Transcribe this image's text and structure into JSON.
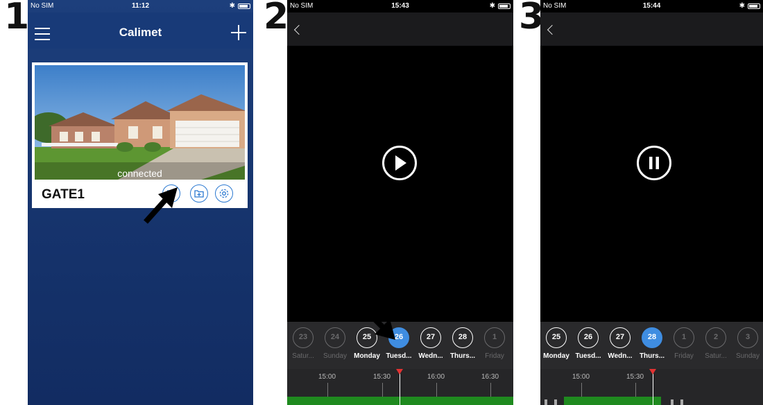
{
  "steps": [
    "1",
    "2",
    "3"
  ],
  "phone1": {
    "status": {
      "carrier": "No SIM",
      "time": "11:12"
    },
    "title": "Calimet",
    "card": {
      "status": "connected",
      "name": "GATE1"
    },
    "icons": [
      "menu-icon",
      "add-icon",
      "playback-list-icon",
      "add-folder-icon",
      "gear-icon"
    ]
  },
  "phone2": {
    "status": {
      "carrier": "No SIM",
      "time": "15:43"
    },
    "control": "play-icon",
    "days": [
      {
        "num": "23",
        "label": "Satur...",
        "state": "dim"
      },
      {
        "num": "24",
        "label": "Sunday",
        "state": "dim"
      },
      {
        "num": "25",
        "label": "Monday",
        "state": "active"
      },
      {
        "num": "26",
        "label": "Tuesd...",
        "state": "selected"
      },
      {
        "num": "27",
        "label": "Wedn...",
        "state": "active"
      },
      {
        "num": "28",
        "label": "Thurs...",
        "state": "active"
      },
      {
        "num": "1",
        "label": "Friday",
        "state": "dim"
      }
    ],
    "timeline": [
      "15:00",
      "15:30",
      "16:00",
      "16:30"
    ]
  },
  "phone3": {
    "status": {
      "carrier": "No SIM",
      "time": "15:44"
    },
    "control": "pause-icon",
    "days": [
      {
        "num": "25",
        "label": "Monday",
        "state": "active"
      },
      {
        "num": "26",
        "label": "Tuesd...",
        "state": "active"
      },
      {
        "num": "27",
        "label": "Wedn...",
        "state": "active"
      },
      {
        "num": "28",
        "label": "Thurs...",
        "state": "selected"
      },
      {
        "num": "1",
        "label": "Friday",
        "state": "dim"
      },
      {
        "num": "2",
        "label": "Satur...",
        "state": "dim"
      },
      {
        "num": "3",
        "label": "Sunday",
        "state": "dim"
      }
    ],
    "timeline": [
      "15:00",
      "15:30"
    ]
  },
  "colors": {
    "nav_blue": "#183a78",
    "accent": "#3f8de1",
    "recording": "#1f8a1f",
    "cursor": "#e23232"
  }
}
